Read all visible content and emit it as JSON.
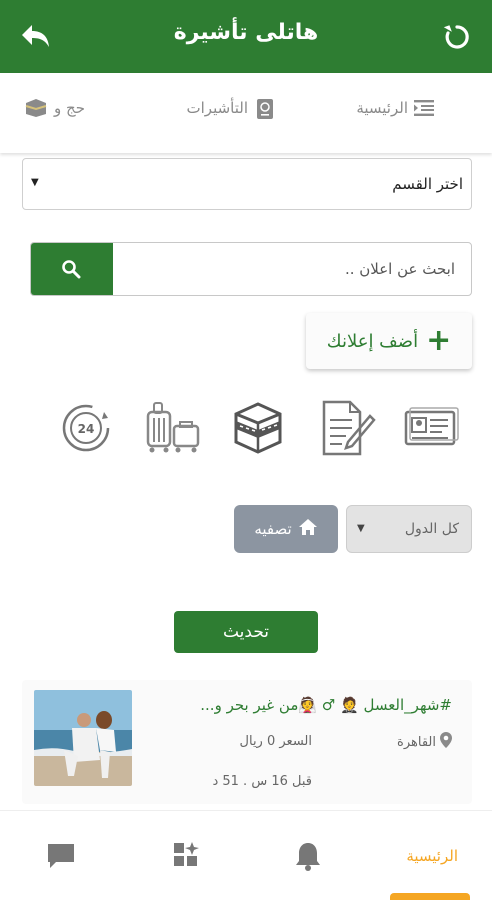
{
  "header": {
    "title": "هاتلى تأشيرة",
    "bg_color": "#2e7d32"
  },
  "categories": [
    {
      "label": "الرئيسية",
      "icon": "list-icon"
    },
    {
      "label": "التأشيرات",
      "icon": "passport-icon"
    },
    {
      "label": "حج و",
      "icon": "kaaba-icon"
    }
  ],
  "section_select": {
    "value": "اختر القسم"
  },
  "search": {
    "placeholder": "ابحث عن اعلان .."
  },
  "add_ad": {
    "label": "أضف إعلانك"
  },
  "services": [
    "24h-icon",
    "luggage-icon",
    "kaaba-icon",
    "document-edit-icon",
    "id-card-icon"
  ],
  "filters": {
    "country_value": "كل الدول",
    "filter_label": "تصفيه"
  },
  "refresh_label": "تحديث",
  "listing": {
    "title": "#شهر_العسل 🤵 ♂ 👰من غير بحر و...",
    "location": "القاهرة",
    "price": "السعر 0 ريال",
    "time": "قبل 16 س . 51 د"
  },
  "bottom_nav": {
    "home_label": "الرئيسية",
    "active_color": "#f5a623"
  }
}
